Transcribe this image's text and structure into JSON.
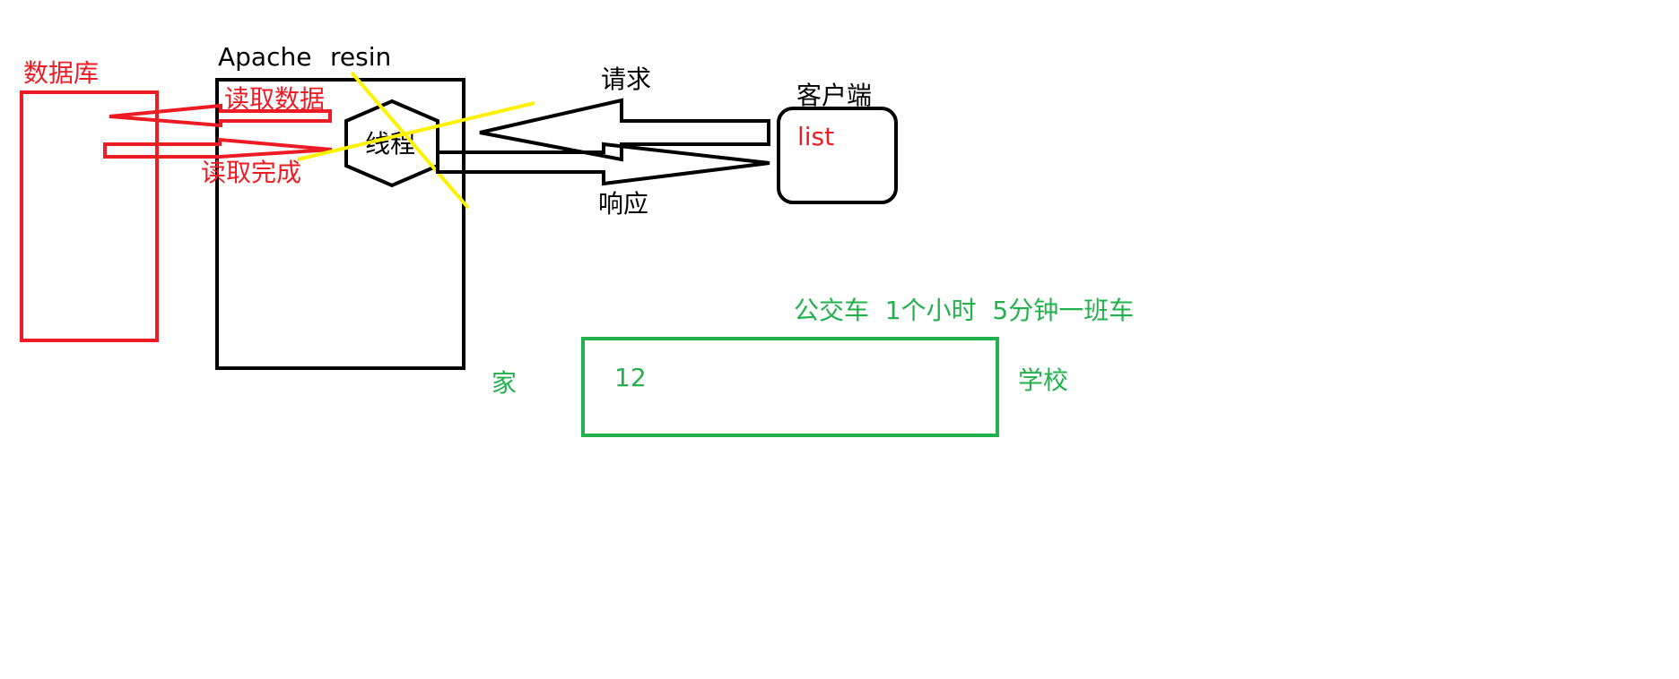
{
  "colors": {
    "ink": "#000000",
    "red": "#ed1c24",
    "green": "#22b14c",
    "yellow": "#fff200",
    "background": "#ffffff"
  },
  "labels": {
    "database": "数据库",
    "apache": "Apache",
    "resin": "resin",
    "read_data": "读取数据",
    "read_done": "读取完成",
    "thread": "线程",
    "request": "请求",
    "response": "响应",
    "client": "客户端",
    "list": "list",
    "bus_note": "公交车  1个小时  5分钟一班车",
    "home": "家",
    "bus_count": "12",
    "school": "学校"
  }
}
